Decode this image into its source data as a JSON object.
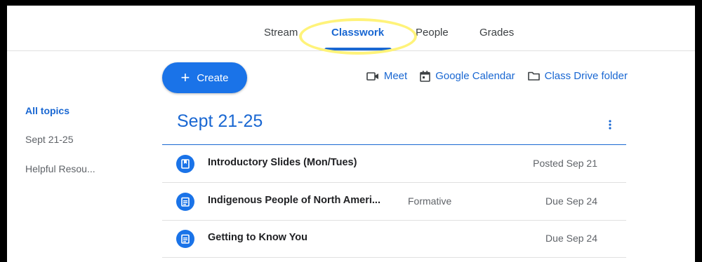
{
  "tabs": [
    {
      "label": "Stream"
    },
    {
      "label": "Classwork"
    },
    {
      "label": "People"
    },
    {
      "label": "Grades"
    }
  ],
  "active_tab": "Classwork",
  "create_button": {
    "label": "Create"
  },
  "links": {
    "meet": "Meet",
    "calendar": "Google Calendar",
    "drive": "Class Drive folder"
  },
  "sidebar": {
    "items": [
      {
        "label": "All topics"
      },
      {
        "label": "Sept 21-25"
      },
      {
        "label": "Helpful Resou..."
      }
    ]
  },
  "topic": {
    "title": "Sept 21-25",
    "items": [
      {
        "icon": "material-icon",
        "title": "Introductory Slides (Mon/Tues)",
        "tag": "",
        "date": "Posted Sep 21"
      },
      {
        "icon": "assignment-icon",
        "title": "Indigenous People of North Ameri...",
        "tag": "Formative",
        "date": "Due Sep 24"
      },
      {
        "icon": "assignment-icon",
        "title": "Getting to Know You",
        "tag": "",
        "date": "Due Sep 24"
      }
    ]
  },
  "colors": {
    "accent": "#1967d2",
    "button": "#1a73e8",
    "highlight": "#fff37a"
  }
}
